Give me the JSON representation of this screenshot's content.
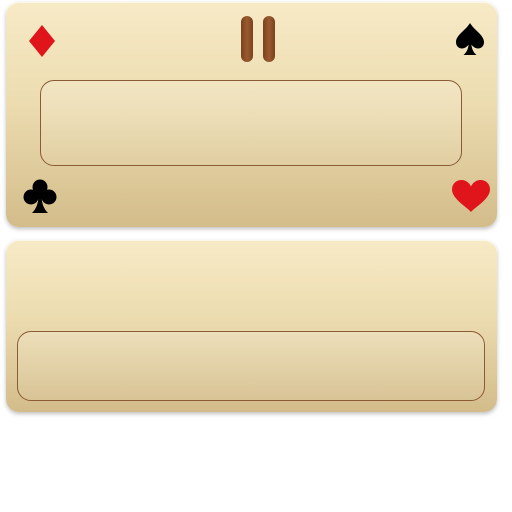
{
  "screen": {
    "background": "#ffffff"
  },
  "top_panel": {
    "pause_button": {
      "icon": "pause-icon",
      "color": "#8a4c26"
    },
    "suits": {
      "top_left": {
        "icon": "diamond-icon",
        "color": "#e0141b"
      },
      "top_right": {
        "icon": "spade-icon",
        "color": "#000000"
      },
      "bottom_left": {
        "icon": "club-icon",
        "color": "#000000"
      },
      "bottom_right": {
        "icon": "heart-icon",
        "color": "#e0141b"
      }
    },
    "text_slot": {
      "text": ""
    }
  },
  "bottom_panel": {
    "text_slot": {
      "text": ""
    }
  },
  "colors": {
    "panel_light": "#f7eac6",
    "panel_dark": "#d3bc8a",
    "slot_border": "#8b5a36"
  }
}
